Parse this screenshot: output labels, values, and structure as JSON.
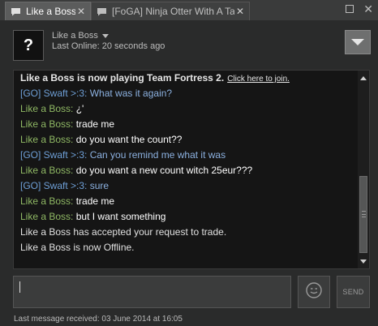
{
  "tabs": [
    {
      "label": "Like a Boss",
      "close": "✕"
    },
    {
      "label": "[FoGA] Ninja Otter With A Taco",
      "close": "✕"
    }
  ],
  "window": {
    "close": "✕"
  },
  "friend": {
    "avatar_glyph": "?",
    "name": "Like a Boss",
    "status": "Last Online: 20 seconds ago"
  },
  "chat": {
    "system_text": "Like a Boss is now playing Team Fortress 2.",
    "join_link": "Click here to join.",
    "messages": [
      {
        "name": "[GO] Swaft >:3",
        "sep": ": ",
        "text": "What was it again?",
        "who": "swaft"
      },
      {
        "name": "Like a Boss",
        "sep": ": ",
        "text": "¿'",
        "who": "boss"
      },
      {
        "name": "Like a Boss",
        "sep": ": ",
        "text": "trade me",
        "who": "boss"
      },
      {
        "name": "Like a Boss",
        "sep": ": ",
        "text": "do you want the count??",
        "who": "boss"
      },
      {
        "name": "[GO] Swaft >:3",
        "sep": ": ",
        "text": "Can you remind me what it was",
        "who": "swaft"
      },
      {
        "name": "Like a Boss",
        "sep": ": ",
        "text": "do you want a new count witch 25eur???",
        "who": "boss"
      },
      {
        "name": "[GO] Swaft >:3",
        "sep": ": ",
        "text": "sure",
        "who": "swaft"
      },
      {
        "name": "Like a Boss",
        "sep": ": ",
        "text": "trade me",
        "who": "boss"
      },
      {
        "name": "Like a Boss",
        "sep": ": ",
        "text": "but I want something",
        "who": "boss"
      }
    ],
    "notices": [
      "Like a Boss has accepted your request to trade.",
      "Like a Boss is now Offline."
    ]
  },
  "input": {
    "value": ""
  },
  "send_label": "SEND",
  "footer": "Last message received: 03 June 2014 at 16:05",
  "icons": {
    "tab_chat": "chat-bubble-icon",
    "dropdown": "chevron-down-icon",
    "emoticon": "emoticon-icon"
  },
  "colors": {
    "name_boss": "#8fb864",
    "name_swaft": "#6e9fd6",
    "background": "#2a2b2b",
    "chat_bg": "#151515"
  }
}
